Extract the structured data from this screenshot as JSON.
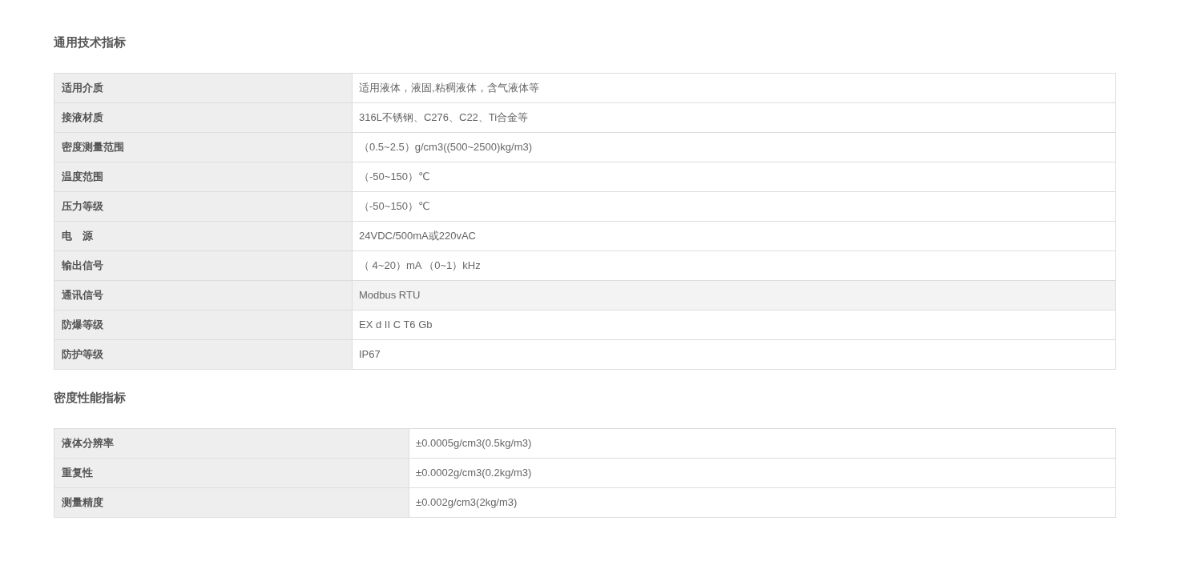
{
  "sections": [
    {
      "title": "通用技术指标",
      "rows": [
        {
          "label": "适用介质",
          "value": "适用液体，液固,粘稠液体，含气液体等",
          "highlighted": false
        },
        {
          "label": "接液材质",
          "value": "316L不锈钢、C276、C22、Ti合金等",
          "highlighted": false
        },
        {
          "label": "密度测量范围",
          "value": "（0.5~2.5）g/cm3((500~2500)kg/m3)",
          "highlighted": false
        },
        {
          "label": "温度范围",
          "value": "（-50~150）℃",
          "highlighted": false
        },
        {
          "label": "压力等级",
          "value": "（-50~150）℃",
          "highlighted": false
        },
        {
          "label": "电　源",
          "value": "24VDC/500mA或220vAC",
          "highlighted": false
        },
        {
          "label": "输出信号",
          "value": "（ 4~20）mA （0~1）kHz",
          "highlighted": false
        },
        {
          "label": "通讯信号",
          "value": "Modbus RTU",
          "highlighted": true
        },
        {
          "label": "防爆等级",
          "value": "EX d II C T6 Gb",
          "highlighted": false
        },
        {
          "label": "防护等级",
          "value": "IP67",
          "highlighted": false
        }
      ]
    },
    {
      "title": "密度性能指标",
      "rows": [
        {
          "label": "液体分辨率",
          "value": "±0.0005g/cm3(0.5kg/m3)",
          "highlighted": false
        },
        {
          "label": "重复性",
          "value": "±0.0002g/cm3(0.2kg/m3)",
          "highlighted": false
        },
        {
          "label": "测量精度",
          "value": "±0.002g/cm3(2kg/m3)",
          "highlighted": false
        }
      ]
    }
  ]
}
